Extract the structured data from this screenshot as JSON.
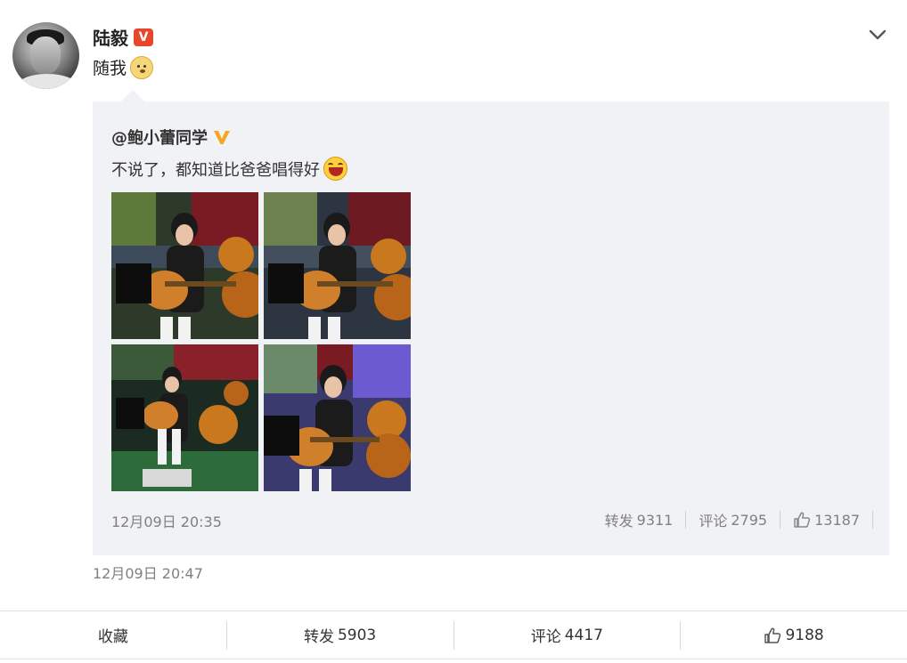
{
  "post": {
    "author": "陆毅",
    "verified_badge": "V",
    "text": "随我",
    "emoji": "doge-emoji",
    "time": "12月09日 20:47"
  },
  "repost": {
    "author": "@鲍小蕾同学",
    "text": "不说了，都知道比爸爸唱得好",
    "emoji": "laugh-emoji",
    "time": "12月09日 20:35",
    "actions": {
      "forward_label": "转发",
      "forward_count": "9311",
      "comment_label": "评论",
      "comment_count": "2795",
      "like_count": "13187"
    },
    "photos": [
      "girl-playing-guitar-1",
      "girl-playing-guitar-2",
      "girl-playing-guitar-3",
      "girl-playing-guitar-4"
    ]
  },
  "bottom_bar": {
    "favorite_label": "收藏",
    "forward_label": "转发",
    "forward_count": "5903",
    "comment_label": "评论",
    "comment_count": "4417",
    "like_count": "9188"
  },
  "colors": {
    "verified_red": "#e8462a",
    "verified_gold": "#f5a623",
    "repost_bg": "#f1f2f5",
    "muted_text": "#808080"
  }
}
